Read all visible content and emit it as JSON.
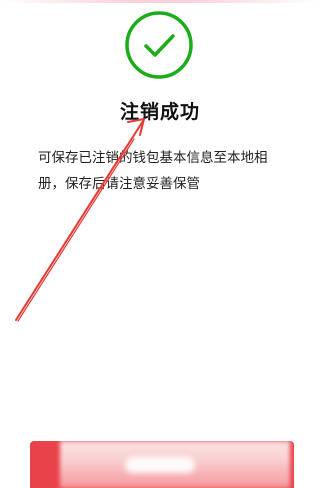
{
  "status": {
    "title": "注销成功",
    "icon": "check-circle-icon",
    "accent_color": "#1aad19"
  },
  "message": {
    "line1": "可保存已注销的钱包基本信息至本地相",
    "line2": "册，保存后请注意妥善保管"
  },
  "annotation": {
    "color": "#e53935",
    "type": "arrow"
  },
  "bottom_button": {
    "color": "#e8434a"
  }
}
